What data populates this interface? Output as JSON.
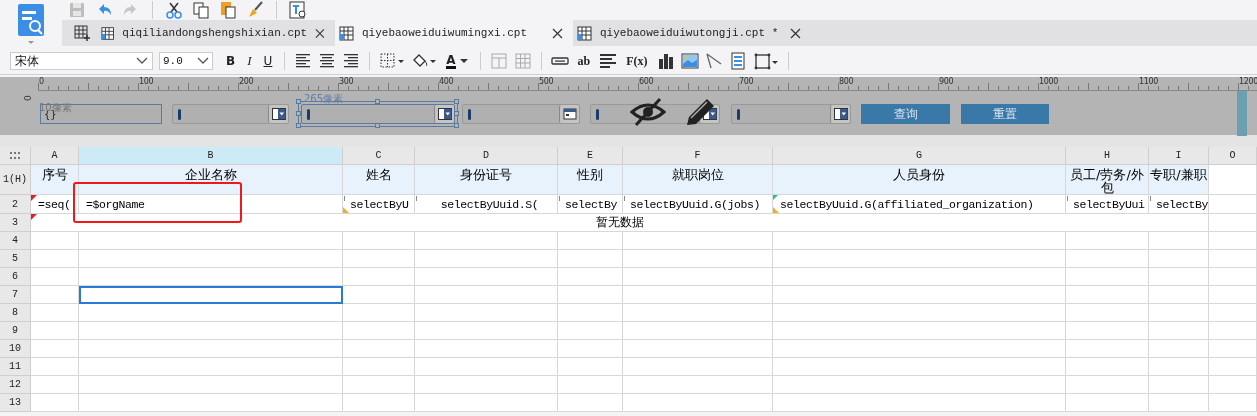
{
  "toolbar": {
    "buttons": [
      {
        "kind": "save",
        "disabled": true
      },
      {
        "kind": "undo",
        "disabled": false
      },
      {
        "kind": "redo",
        "disabled": true
      },
      {
        "kind": "cut",
        "disabled": false
      },
      {
        "kind": "copy",
        "disabled": false
      },
      {
        "kind": "paste",
        "disabled": false
      },
      {
        "kind": "brush",
        "disabled": false
      },
      {
        "kind": "find",
        "disabled": false
      }
    ]
  },
  "tabs": [
    {
      "label": "qiqiliandongshengshixian.cpt",
      "selected": false
    },
    {
      "label": "qiyebaoweiduiwumingxi.cpt",
      "selected": true
    },
    {
      "label": "qiyebaoweiduiwutongji.cpt *",
      "selected": false
    }
  ],
  "format_bar": {
    "font": "宋体",
    "size": "9.0",
    "tools": [
      {
        "kind": "bold",
        "label": "B"
      },
      {
        "kind": "italic",
        "label": "I"
      },
      {
        "kind": "underline",
        "label": "U"
      },
      {
        "kind": "sep"
      },
      {
        "kind": "align-left"
      },
      {
        "kind": "align-center"
      },
      {
        "kind": "align-right"
      },
      {
        "kind": "sep"
      },
      {
        "kind": "border"
      },
      {
        "kind": "fill"
      },
      {
        "kind": "color",
        "label": "A"
      },
      {
        "kind": "sep"
      },
      {
        "kind": "merge"
      },
      {
        "kind": "grid"
      },
      {
        "kind": "sep"
      },
      {
        "kind": "textfield"
      },
      {
        "kind": "text",
        "label": "ab"
      },
      {
        "kind": "lines"
      },
      {
        "kind": "text",
        "label": "F(x)"
      },
      {
        "kind": "chart"
      },
      {
        "kind": "image"
      },
      {
        "kind": "slash"
      },
      {
        "kind": "subreport"
      },
      {
        "kind": "frame"
      },
      {
        "kind": "sep"
      }
    ]
  },
  "ruler": [
    "0",
    "100",
    "200",
    "300",
    "400",
    "500",
    "600",
    "700",
    "800",
    "900",
    "1000",
    "1100",
    "1200"
  ],
  "vruler": "0",
  "form": {
    "widgets": [
      {
        "kind": "label",
        "text": "{}",
        "dimension": "10像素"
      },
      {
        "kind": "combo",
        "selected": false
      },
      {
        "kind": "combo",
        "selected": true,
        "dimension": "265像素"
      },
      {
        "kind": "date",
        "selected": false
      },
      {
        "kind": "combo",
        "selected": false
      },
      {
        "kind": "eye"
      },
      {
        "kind": "pencil"
      },
      {
        "kind": "combo",
        "selected": false
      },
      {
        "kind": "button",
        "text": "查询"
      },
      {
        "kind": "button",
        "text": "重置"
      }
    ]
  },
  "sheet": {
    "columns": [
      {
        "label": "A",
        "selected": false
      },
      {
        "label": "B",
        "selected": true
      },
      {
        "label": "C",
        "selected": false
      },
      {
        "label": "D",
        "selected": false
      },
      {
        "label": "E",
        "selected": false
      },
      {
        "label": "F",
        "selected": false
      },
      {
        "label": "G",
        "selected": false
      },
      {
        "label": "H",
        "selected": false
      },
      {
        "label": "I",
        "selected": false
      },
      {
        "label": "O",
        "selected": false
      }
    ],
    "rows": [
      {
        "label": "1(H)",
        "kind": "header",
        "selected": false,
        "cells": [
          {
            "text": "序号"
          },
          {
            "text": "企业名称"
          },
          {
            "text": "姓名"
          },
          {
            "text": "身份证号"
          },
          {
            "text": "性别"
          },
          {
            "text": "就职岗位"
          },
          {
            "text": "人员身份"
          },
          {
            "text": "员工/劳务/外包"
          },
          {
            "text": "专职/兼职"
          }
        ]
      },
      {
        "label": "2",
        "kind": "formula",
        "selected": false,
        "cells": [
          {
            "text": "=seq(",
            "formula_mark": true
          },
          {
            "text": "=$orgName"
          },
          {
            "text": "selectByU",
            "expand_mark": true,
            "condition_mark": true
          },
          {
            "text": "selectByUuid.S(",
            "expand_mark": true,
            "centered": true
          },
          {
            "text": "selectBy",
            "expand_mark": true
          },
          {
            "text": "selectByUuid.G(jobs)",
            "expand_mark": true
          },
          {
            "text": "selectByUuid.G(affiliated_organization)",
            "filter_mark": true,
            "condition_mark": true
          },
          {
            "text": "selectByUui",
            "expand_mark": true
          },
          {
            "text": "selectBy",
            "expand_mark": true
          }
        ]
      },
      {
        "label": "3",
        "kind": "merged",
        "selected": false,
        "cells": [
          {
            "text": "暂无数据",
            "formula_mark": true
          }
        ]
      },
      {
        "label": "4",
        "kind": "empty",
        "selected": false
      },
      {
        "label": "5",
        "kind": "empty",
        "selected": false
      },
      {
        "label": "6",
        "kind": "empty",
        "selected": false
      },
      {
        "label": "7",
        "kind": "empty",
        "selected": true
      },
      {
        "label": "8",
        "kind": "empty",
        "selected": false
      },
      {
        "label": "9",
        "kind": "empty",
        "selected": false
      },
      {
        "label": "10",
        "kind": "empty",
        "selected": false
      },
      {
        "label": "11",
        "kind": "empty",
        "selected": false
      },
      {
        "label": "12",
        "kind": "empty",
        "selected": false
      },
      {
        "label": "13",
        "kind": "empty",
        "selected": false
      }
    ]
  },
  "highlight": {
    "shown": true
  }
}
